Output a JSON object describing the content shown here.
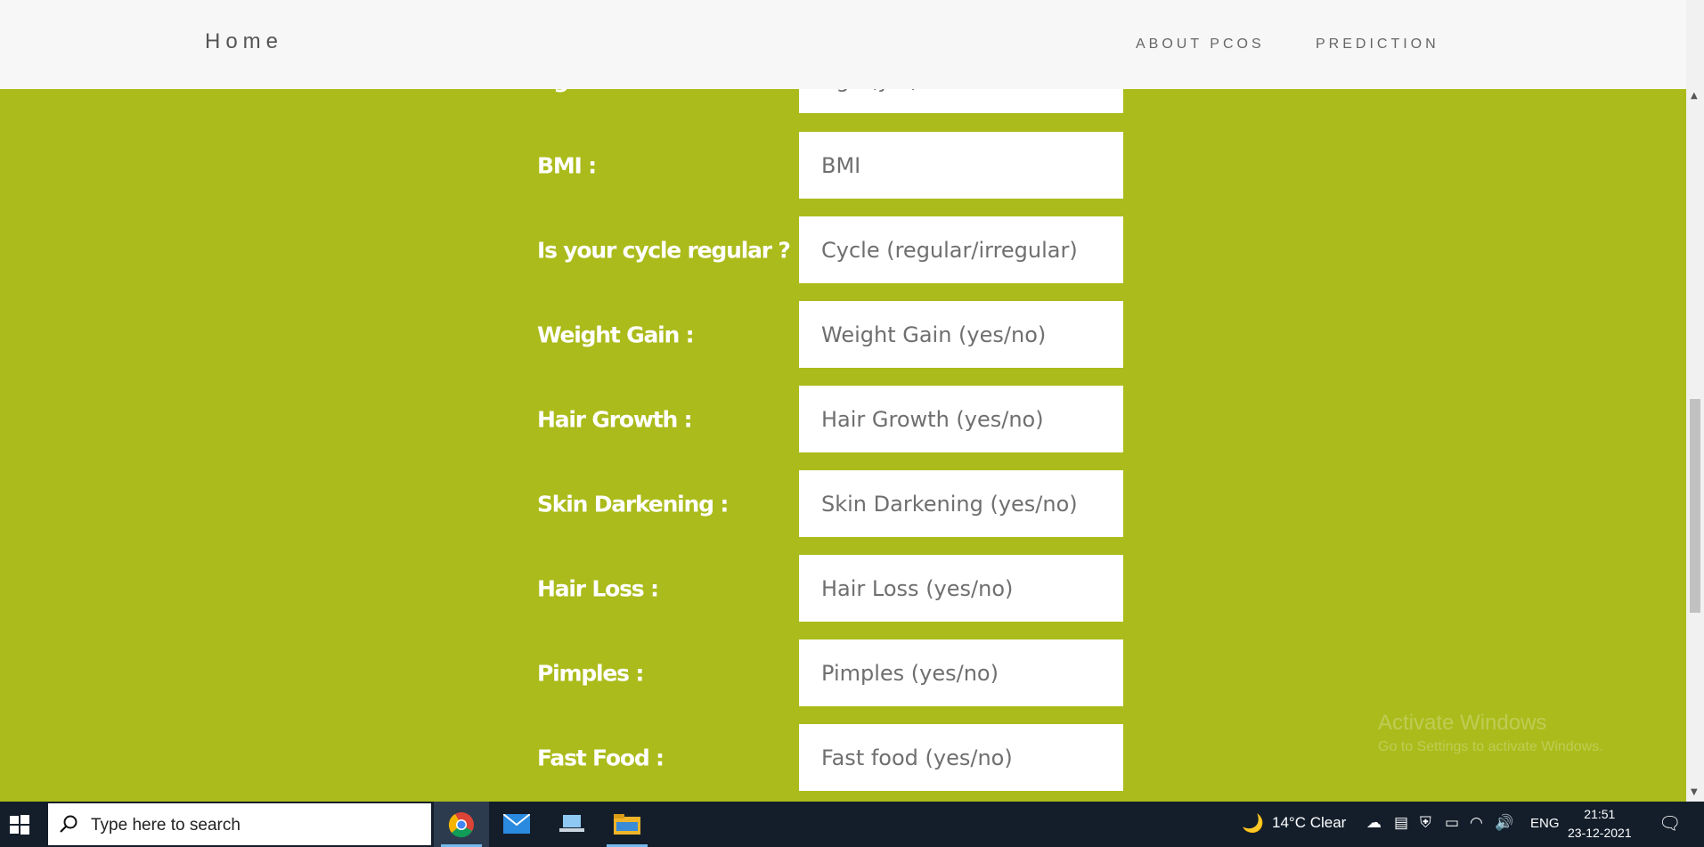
{
  "nav": {
    "brand": "Home",
    "links": [
      "ABOUT PCOS",
      "PREDICTION"
    ]
  },
  "form": {
    "partial_top_placeholder": "Age (yrs)",
    "fields": [
      {
        "label": "BMI :",
        "placeholder": "BMI"
      },
      {
        "label": "Is your cycle regular ? :",
        "placeholder": "Cycle (regular/irregular)"
      },
      {
        "label": "Weight Gain :",
        "placeholder": "Weight Gain (yes/no)"
      },
      {
        "label": "Hair Growth :",
        "placeholder": "Hair Growth (yes/no)"
      },
      {
        "label": "Skin Darkening :",
        "placeholder": "Skin Darkening (yes/no)"
      },
      {
        "label": "Hair Loss :",
        "placeholder": "Hair Loss (yes/no)"
      },
      {
        "label": "Pimples :",
        "placeholder": "Pimples (yes/no)"
      },
      {
        "label": "Fast Food :",
        "placeholder": "Fast food (yes/no)"
      }
    ]
  },
  "watermark": {
    "line1": "Activate Windows",
    "line2": "Go to Settings to activate Windows."
  },
  "taskbar": {
    "search_placeholder": "Type here to search",
    "weather": "14°C  Clear",
    "language": "ENG",
    "time": "21:51",
    "date": "23-12-2021"
  },
  "colors": {
    "page_background": "#abbb1b",
    "navbar_background": "#f7f7f7",
    "field_background": "#ffffff",
    "taskbar_background": "#141e2b"
  },
  "icons": [
    "windows-start-icon",
    "search-icon",
    "chrome-icon",
    "mail-icon",
    "laptop-icon",
    "file-explorer-icon",
    "moon-icon",
    "cloud-icon",
    "shield-icon",
    "battery-icon",
    "wifi-icon",
    "speaker-icon",
    "notification-icon"
  ]
}
